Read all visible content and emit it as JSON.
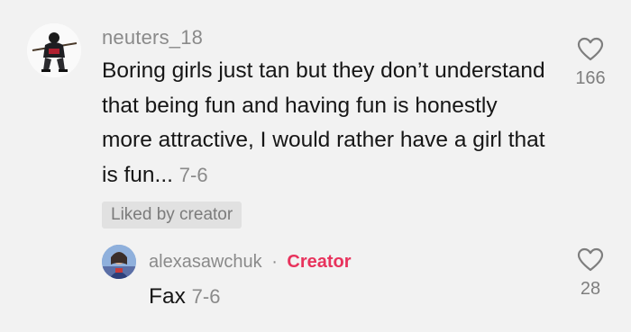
{
  "comment": {
    "username": "neuters_18",
    "text": "Boring girls just tan but they don’t understand that being fun and having fun is honestly more attractive, I would rather have a girl that is fun...",
    "timestamp": "7-6",
    "likes": "166",
    "liked_by_badge": "Liked by creator",
    "avatar_icon": "hockey-player-avatar"
  },
  "reply": {
    "username": "alexasawchuk",
    "separator": "·",
    "creator_tag": "Creator",
    "text": "Fax",
    "timestamp": "7-6",
    "likes": "28",
    "avatar_icon": "user-photo-avatar"
  },
  "colors": {
    "background": "#f2f2f2",
    "creator_accent": "#e8325c",
    "muted_text": "#8a8a8a",
    "body_text": "#161616",
    "badge_bg": "#e1e1e1"
  }
}
